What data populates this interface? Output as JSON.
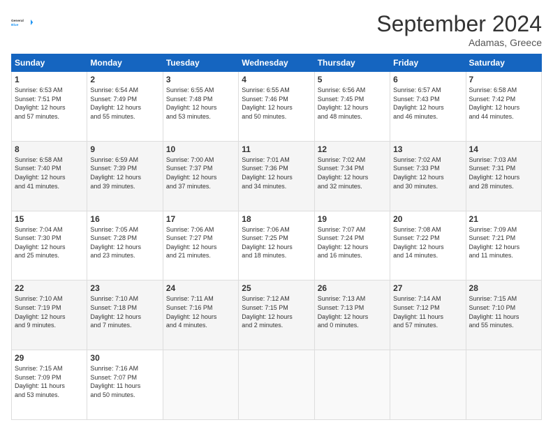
{
  "header": {
    "logo_line1": "General",
    "logo_line2": "Blue",
    "month_title": "September 2024",
    "location": "Adamas, Greece"
  },
  "weekdays": [
    "Sunday",
    "Monday",
    "Tuesday",
    "Wednesday",
    "Thursday",
    "Friday",
    "Saturday"
  ],
  "weeks": [
    [
      {
        "day": "1",
        "info": "Sunrise: 6:53 AM\nSunset: 7:51 PM\nDaylight: 12 hours\nand 57 minutes."
      },
      {
        "day": "2",
        "info": "Sunrise: 6:54 AM\nSunset: 7:49 PM\nDaylight: 12 hours\nand 55 minutes."
      },
      {
        "day": "3",
        "info": "Sunrise: 6:55 AM\nSunset: 7:48 PM\nDaylight: 12 hours\nand 53 minutes."
      },
      {
        "day": "4",
        "info": "Sunrise: 6:55 AM\nSunset: 7:46 PM\nDaylight: 12 hours\nand 50 minutes."
      },
      {
        "day": "5",
        "info": "Sunrise: 6:56 AM\nSunset: 7:45 PM\nDaylight: 12 hours\nand 48 minutes."
      },
      {
        "day": "6",
        "info": "Sunrise: 6:57 AM\nSunset: 7:43 PM\nDaylight: 12 hours\nand 46 minutes."
      },
      {
        "day": "7",
        "info": "Sunrise: 6:58 AM\nSunset: 7:42 PM\nDaylight: 12 hours\nand 44 minutes."
      }
    ],
    [
      {
        "day": "8",
        "info": "Sunrise: 6:58 AM\nSunset: 7:40 PM\nDaylight: 12 hours\nand 41 minutes."
      },
      {
        "day": "9",
        "info": "Sunrise: 6:59 AM\nSunset: 7:39 PM\nDaylight: 12 hours\nand 39 minutes."
      },
      {
        "day": "10",
        "info": "Sunrise: 7:00 AM\nSunset: 7:37 PM\nDaylight: 12 hours\nand 37 minutes."
      },
      {
        "day": "11",
        "info": "Sunrise: 7:01 AM\nSunset: 7:36 PM\nDaylight: 12 hours\nand 34 minutes."
      },
      {
        "day": "12",
        "info": "Sunrise: 7:02 AM\nSunset: 7:34 PM\nDaylight: 12 hours\nand 32 minutes."
      },
      {
        "day": "13",
        "info": "Sunrise: 7:02 AM\nSunset: 7:33 PM\nDaylight: 12 hours\nand 30 minutes."
      },
      {
        "day": "14",
        "info": "Sunrise: 7:03 AM\nSunset: 7:31 PM\nDaylight: 12 hours\nand 28 minutes."
      }
    ],
    [
      {
        "day": "15",
        "info": "Sunrise: 7:04 AM\nSunset: 7:30 PM\nDaylight: 12 hours\nand 25 minutes."
      },
      {
        "day": "16",
        "info": "Sunrise: 7:05 AM\nSunset: 7:28 PM\nDaylight: 12 hours\nand 23 minutes."
      },
      {
        "day": "17",
        "info": "Sunrise: 7:06 AM\nSunset: 7:27 PM\nDaylight: 12 hours\nand 21 minutes."
      },
      {
        "day": "18",
        "info": "Sunrise: 7:06 AM\nSunset: 7:25 PM\nDaylight: 12 hours\nand 18 minutes."
      },
      {
        "day": "19",
        "info": "Sunrise: 7:07 AM\nSunset: 7:24 PM\nDaylight: 12 hours\nand 16 minutes."
      },
      {
        "day": "20",
        "info": "Sunrise: 7:08 AM\nSunset: 7:22 PM\nDaylight: 12 hours\nand 14 minutes."
      },
      {
        "day": "21",
        "info": "Sunrise: 7:09 AM\nSunset: 7:21 PM\nDaylight: 12 hours\nand 11 minutes."
      }
    ],
    [
      {
        "day": "22",
        "info": "Sunrise: 7:10 AM\nSunset: 7:19 PM\nDaylight: 12 hours\nand 9 minutes."
      },
      {
        "day": "23",
        "info": "Sunrise: 7:10 AM\nSunset: 7:18 PM\nDaylight: 12 hours\nand 7 minutes."
      },
      {
        "day": "24",
        "info": "Sunrise: 7:11 AM\nSunset: 7:16 PM\nDaylight: 12 hours\nand 4 minutes."
      },
      {
        "day": "25",
        "info": "Sunrise: 7:12 AM\nSunset: 7:15 PM\nDaylight: 12 hours\nand 2 minutes."
      },
      {
        "day": "26",
        "info": "Sunrise: 7:13 AM\nSunset: 7:13 PM\nDaylight: 12 hours\nand 0 minutes."
      },
      {
        "day": "27",
        "info": "Sunrise: 7:14 AM\nSunset: 7:12 PM\nDaylight: 11 hours\nand 57 minutes."
      },
      {
        "day": "28",
        "info": "Sunrise: 7:15 AM\nSunset: 7:10 PM\nDaylight: 11 hours\nand 55 minutes."
      }
    ],
    [
      {
        "day": "29",
        "info": "Sunrise: 7:15 AM\nSunset: 7:09 PM\nDaylight: 11 hours\nand 53 minutes."
      },
      {
        "day": "30",
        "info": "Sunrise: 7:16 AM\nSunset: 7:07 PM\nDaylight: 11 hours\nand 50 minutes."
      },
      {
        "day": "",
        "info": ""
      },
      {
        "day": "",
        "info": ""
      },
      {
        "day": "",
        "info": ""
      },
      {
        "day": "",
        "info": ""
      },
      {
        "day": "",
        "info": ""
      }
    ]
  ]
}
